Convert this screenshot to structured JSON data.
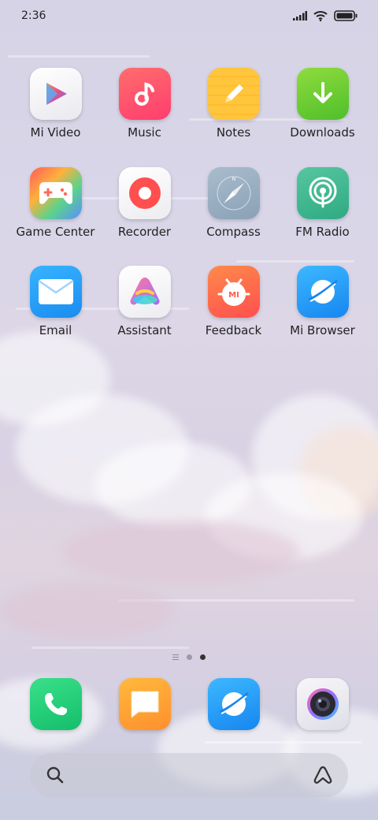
{
  "status_bar": {
    "time": "2:36"
  },
  "apps": [
    {
      "label": "Mi Video",
      "icon": "play-icon"
    },
    {
      "label": "Music",
      "icon": "music-note-icon"
    },
    {
      "label": "Notes",
      "icon": "pencil-icon"
    },
    {
      "label": "Downloads",
      "icon": "download-arrow-icon"
    },
    {
      "label": "Game Center",
      "icon": "gamepad-icon"
    },
    {
      "label": "Recorder",
      "icon": "record-icon"
    },
    {
      "label": "Compass",
      "icon": "compass-icon"
    },
    {
      "label": "FM Radio",
      "icon": "radio-icon"
    },
    {
      "label": "Email",
      "icon": "envelope-icon"
    },
    {
      "label": "Assistant",
      "icon": "assistant-icon"
    },
    {
      "label": "Feedback",
      "icon": "feedback-mi-icon"
    },
    {
      "label": "Mi Browser",
      "icon": "browser-planet-icon"
    }
  ],
  "feedback_badge": "MI",
  "dock": [
    {
      "icon": "phone-icon"
    },
    {
      "icon": "messages-icon"
    },
    {
      "icon": "browser-planet-icon"
    },
    {
      "icon": "camera-icon"
    }
  ],
  "search": {
    "left_icon": "search-icon",
    "right_icon": "assistant-icon"
  },
  "page_indicator": {
    "pages": 2,
    "current": 2
  }
}
